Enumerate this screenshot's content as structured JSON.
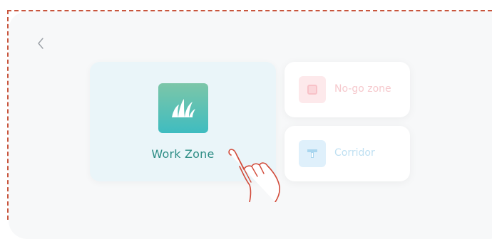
{
  "zones": {
    "work": {
      "label": "Work Zone",
      "icon": "grass-icon"
    },
    "nogo": {
      "label": "No-go zone",
      "icon": "no-go-square-icon"
    },
    "corridor": {
      "label": "Corridor",
      "icon": "corridor-icon"
    }
  },
  "colors": {
    "work_accent": "#2f8e86",
    "nogo_accent": "#f6c9cd",
    "corridor_accent": "#bfe0f2",
    "frame_dash": "#c8553d"
  }
}
